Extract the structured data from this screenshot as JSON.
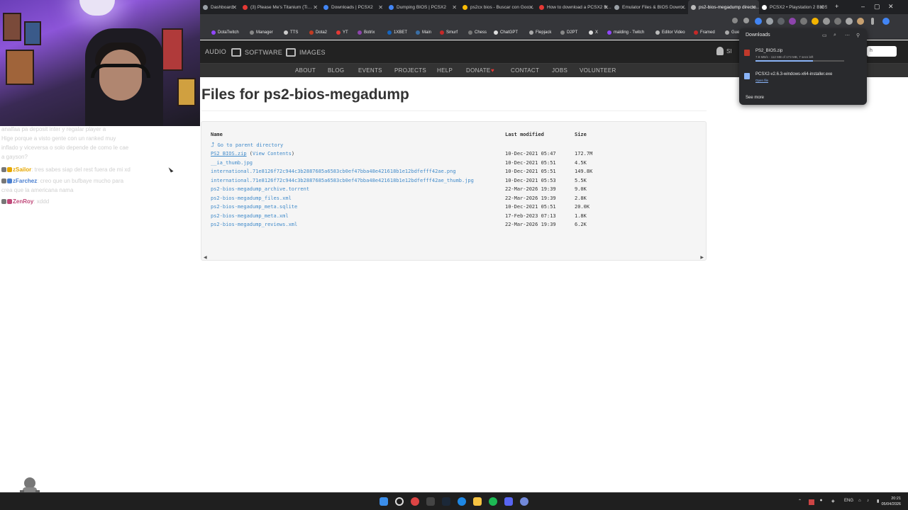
{
  "tabs": [
    {
      "label": "Dashboard",
      "color": "#9aa0a6",
      "active": false
    },
    {
      "label": "(3) Please Me's Titanium (Ti…",
      "color": "#e53935",
      "active": false
    },
    {
      "label": "Downloads | PCSX2",
      "color": "#4285f4",
      "active": false
    },
    {
      "label": "Dumping BIOS | PCSX2",
      "color": "#4285f4",
      "active": false
    },
    {
      "label": "ps2cx bios - Buscar con Goo…",
      "color": "#fbbc05",
      "active": false
    },
    {
      "label": "How to download a PCSX2 B…",
      "color": "#e53935",
      "active": false
    },
    {
      "label": "Emulator Files & BIOS Down…",
      "color": "#9aa0a6",
      "active": false
    },
    {
      "label": "ps2-bios-megadump directo…",
      "color": "#bbb",
      "active": true
    },
    {
      "label": "PCSX2 • Playstation 2 BIOS (…",
      "color": "#fff",
      "active": false
    }
  ],
  "bookmarks": [
    "DotaTwitch",
    "Manager",
    "TTS",
    "Dota2",
    "YT",
    "Botrix",
    "1XBET",
    "Main",
    "Smurf",
    "Chess",
    "ChatGPT",
    "Flepjack",
    "D2PT",
    "X",
    "malding - Twitch",
    "Editor Video",
    "Framed",
    "Guess The Ga…"
  ],
  "topnav": {
    "audio": "AUDIO",
    "software": "SOFTWARE",
    "images": "IMAGES",
    "user_fragment": "SI"
  },
  "subnav": [
    "ABOUT",
    "BLOG",
    "EVENTS",
    "PROJECTS",
    "HELP",
    "DONATE",
    "CONTACT",
    "JOBS",
    "VOLUNTEER"
  ],
  "page": {
    "title": "Files for ps2-bios-megadump",
    "columns": {
      "name": "Name",
      "modified": "Last modified",
      "size": "Size"
    },
    "parent_link": "Go to parent directory",
    "files": [
      {
        "name": "PS2_BIOS.zip",
        "extra_open": " (",
        "extra_link": "View Contents",
        "extra_close": ")",
        "modified": "10-Dec-2021 05:47",
        "size": "172.7M"
      },
      {
        "name": "__ia_thumb.jpg",
        "modified": "10-Dec-2021 05:51",
        "size": "4.5K"
      },
      {
        "name": "international.71e8126f72c944c3b2887685a6583cb0ef47bba48e421618b1e12bdfefff42ae.png",
        "modified": "10-Dec-2021 05:51",
        "size": "149.8K"
      },
      {
        "name": "international.71e8126f72c944c3b2887685a6583cb0ef47bba48e421618b1e12bdfefff42ae_thumb.jpg",
        "modified": "10-Dec-2021 05:53",
        "size": "5.5K"
      },
      {
        "name": "ps2-bios-megadump_archive.torrent",
        "modified": "22-Mar-2026 19:39",
        "size": "9.0K"
      },
      {
        "name": "ps2-bios-megadump_files.xml",
        "modified": "22-Mar-2026 19:39",
        "size": "2.8K"
      },
      {
        "name": "ps2-bios-megadump_meta.sqlite",
        "modified": "10-Dec-2021 05:51",
        "size": "20.0K"
      },
      {
        "name": "ps2-bios-megadump_meta.xml",
        "modified": "17-Feb-2023 07:13",
        "size": "1.8K"
      },
      {
        "name": "ps2-bios-megadump_reviews.xml",
        "modified": "22-Mar-2026 19:39",
        "size": "6.2K"
      }
    ]
  },
  "downloads": {
    "title": "Downloads",
    "items": [
      {
        "name": "PS2_BIOS.zip",
        "status": "7.8 MB/s - 112 MB of 173 MB, 7 secs left",
        "progress": 0.65
      },
      {
        "name": "PCSX2-v2.6.3-windows-x64-installer.exe",
        "action": "Open file"
      }
    ],
    "see_more": "See more",
    "search_fragment": "h"
  },
  "chat": [
    {
      "user": "",
      "text": "analfaa pa deposit inter y regalar player a",
      "color": ""
    },
    {
      "user": "",
      "text": "Hige porque a visto gente con un ranked muy",
      "color": ""
    },
    {
      "user": "",
      "text": "inflado y viceversa o solo depende de como le cae",
      "color": ""
    },
    {
      "user": "",
      "text": "a gayson?",
      "color": ""
    },
    {
      "user": "zSailor",
      "text": ": tres sabes siap del rest fuera de mi xd",
      "color": "#e6a700"
    },
    {
      "user": "zFarchez",
      "text": ": creo que un bufbaye mucho para",
      "color": "#4a7fd0"
    },
    {
      "user": "",
      "text": "crea que la americana nama",
      "color": ""
    },
    {
      "user": "ZenRoy",
      "text": ": xddd",
      "color": "#c04a7a"
    }
  ],
  "taskbar": {
    "lang": "ENG",
    "time": "20:21",
    "date": "05/04/2026"
  },
  "colors": {
    "link": "#428bca",
    "accent": "#8ab4f8",
    "topnav_bg": "#222222",
    "subnav_bg": "#333333"
  }
}
